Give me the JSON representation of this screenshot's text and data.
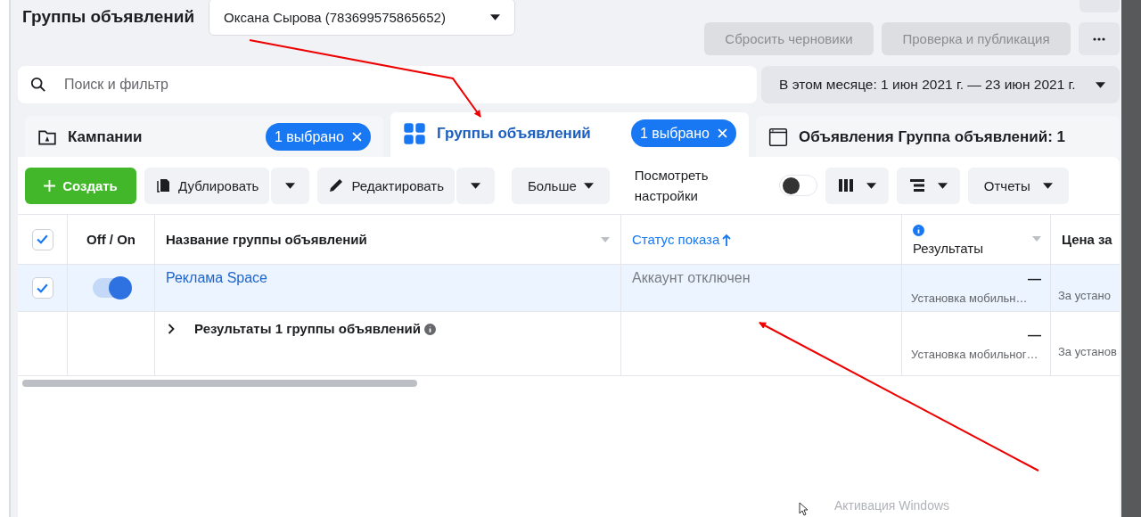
{
  "header": {
    "title": "Группы объявлений",
    "account_select": "Оксана Сырова (783699575865652)"
  },
  "actions": [
    {
      "label": "Сбросить черновики",
      "disabled": true
    },
    {
      "label": "Проверка и публикация",
      "disabled": true
    }
  ],
  "search": {
    "placeholder": "Поиск и фильтр"
  },
  "date_range": "В этом месяце: 1 июн 2021 г. — 23 июн 2021 г.",
  "tabs": [
    {
      "kind": "campaigns",
      "label": "Кампании",
      "badge": "1 выбрано",
      "selected": false
    },
    {
      "kind": "adsets",
      "label": "Группы объявлений",
      "badge": "1 выбрано",
      "selected": true
    },
    {
      "kind": "ads",
      "label": "Объявления Группа объявлений: 1",
      "selected": false
    }
  ],
  "toolbar": {
    "create": "Создать",
    "duplicate": "Дублировать",
    "edit": "Редактировать",
    "more": "Больше",
    "view_settings": {
      "label": "Посмотреть настройки",
      "on": false
    },
    "reports": "Отчеты"
  },
  "table": {
    "all_checked": true,
    "columns": [
      {
        "label": "Off / On",
        "sorted": false
      },
      {
        "label": "Название группы объявлений",
        "sorted": false
      },
      {
        "label": "Статус показа",
        "sorted": true
      },
      {
        "label": "Результаты",
        "sorted": false
      },
      {
        "label": "Цена за",
        "sorted": false
      }
    ],
    "rows": [
      {
        "checked": true,
        "on": true,
        "selected": true,
        "name": "Реклама Space",
        "status": "Аккаунт отключен",
        "results": "—",
        "results_sub": "Установка мобильн…",
        "cost_sub": "За устано"
      }
    ],
    "summary": {
      "label": "Результаты 1 группы объявлений",
      "results": "—",
      "results_sub": "Установка мобильног…",
      "cost_sub": "За установ"
    }
  },
  "windows_notice": "Активация Windows"
}
